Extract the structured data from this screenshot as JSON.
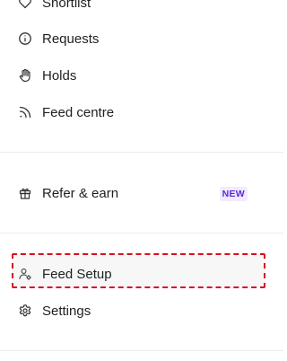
{
  "menu": {
    "items": [
      {
        "label": "Shortlist",
        "icon": "heart-icon"
      },
      {
        "label": "Requests",
        "icon": "info-icon"
      },
      {
        "label": "Holds",
        "icon": "hand-icon"
      },
      {
        "label": "Feed centre",
        "icon": "rss-icon"
      },
      {
        "label": "Refer & earn",
        "icon": "gift-icon"
      },
      {
        "label": "Feed Setup",
        "icon": "user-gear-icon"
      },
      {
        "label": "Settings",
        "icon": "gear-icon"
      }
    ],
    "refer_badge": "NEW"
  },
  "colors": {
    "highlight_border": "#d60f22",
    "badge_text": "#5b2bd6",
    "badge_bg": "#f1ebff"
  }
}
